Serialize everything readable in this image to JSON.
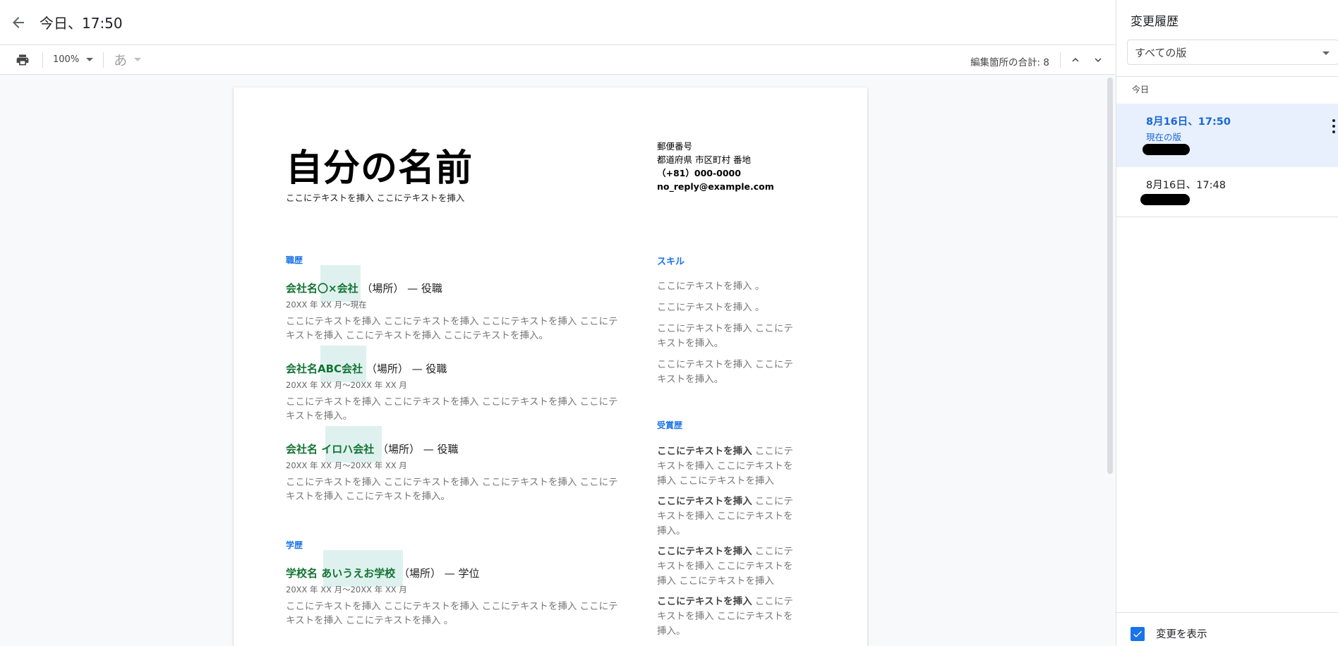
{
  "header": {
    "title": "今日、17:50"
  },
  "toolbar": {
    "zoom": "100%",
    "font_glyph": "あ",
    "edit_total": "編集箇所の合計: 8"
  },
  "doc": {
    "name": "自分の名前",
    "tagline": "ここにテキストを挿入 ここにテキストを挿入",
    "contact": [
      "郵便番号",
      "都道府県 市区町村 番地",
      "（+81）000-0000",
      "no_reply@example.com"
    ],
    "work_heading": "職歴",
    "jobs": [
      {
        "company": "会社名〇×会社",
        "rest": "（場所） — 役職",
        "date": "20XX 年 XX 月～現在",
        "desc": "ここにテキストを挿入 ここにテキストを挿入 ここにテキストを挿入 ここにテキストを挿入 ここにテキストを挿入 ここにテキストを挿入。"
      },
      {
        "company": "会社名ABC会社",
        "rest": "（場所） — 役職",
        "date": "20XX 年 XX 月～20XX 年 XX 月",
        "desc": "ここにテキストを挿入 ここにテキストを挿入 ここにテキストを挿入 ここにテキストを挿入。"
      },
      {
        "company": "会社名 イロハ会社",
        "rest": "（場所） — 役職",
        "date": "20XX 年 XX 月～20XX 年 XX 月",
        "desc": "ここにテキストを挿入 ここにテキストを挿入 ここにテキストを挿入 ここにテキストを挿入 ここにテキストを挿入。"
      }
    ],
    "edu_heading": "学歴",
    "school": {
      "name": "学校名 あいうえお学校",
      "rest": "（場所） — 学位",
      "date": "20XX 年 XX 月～20XX 年 XX 月",
      "desc": "ここにテキストを挿入 ここにテキストを挿入 ここにテキストを挿入 ここにテキストを挿入 ここにテキストを挿入 。"
    },
    "skills_heading": "スキル",
    "skills": [
      "ここにテキストを挿入 。",
      "ここにテキストを挿入 。",
      "ここにテキストを挿入 ここにテキストを挿入。",
      "ここにテキストを挿入 ここにテキストを挿入。"
    ],
    "awards_heading": "受賞歴",
    "awards": [
      {
        "bold": "ここにテキストを挿入",
        "rest": " ここにテキストを挿入 ここにテキストを挿入 ここにテキストを挿入"
      },
      {
        "bold": "ここにテキストを挿入",
        "rest": " ここにテキストを挿入 ここにテキストを挿入。"
      },
      {
        "bold": "ここにテキストを挿入",
        "rest": " ここにテキストを挿入 ここにテキストを挿入 ここにテキストを挿入"
      },
      {
        "bold": "ここにテキストを挿入",
        "rest": " ここにテキストを挿入 ここにテキストを挿入。"
      }
    ]
  },
  "panel": {
    "title": "変更履歴",
    "filter": "すべての版",
    "group": "今日",
    "versions": [
      {
        "time": "8月16日、17:50",
        "sub": "現在の版"
      },
      {
        "time": "8月16日、17:48"
      }
    ],
    "show_changes": "変更を表示"
  },
  "colors": {
    "accent": "#1a73e8",
    "company_green": "#137333",
    "highlight": "#dff1ee",
    "active_bg": "#e8f0fe"
  },
  "icons": [
    "back-arrow-icon",
    "print-icon",
    "chevron-up-icon",
    "chevron-down-icon",
    "more-vert-icon",
    "checkmark-icon"
  ]
}
